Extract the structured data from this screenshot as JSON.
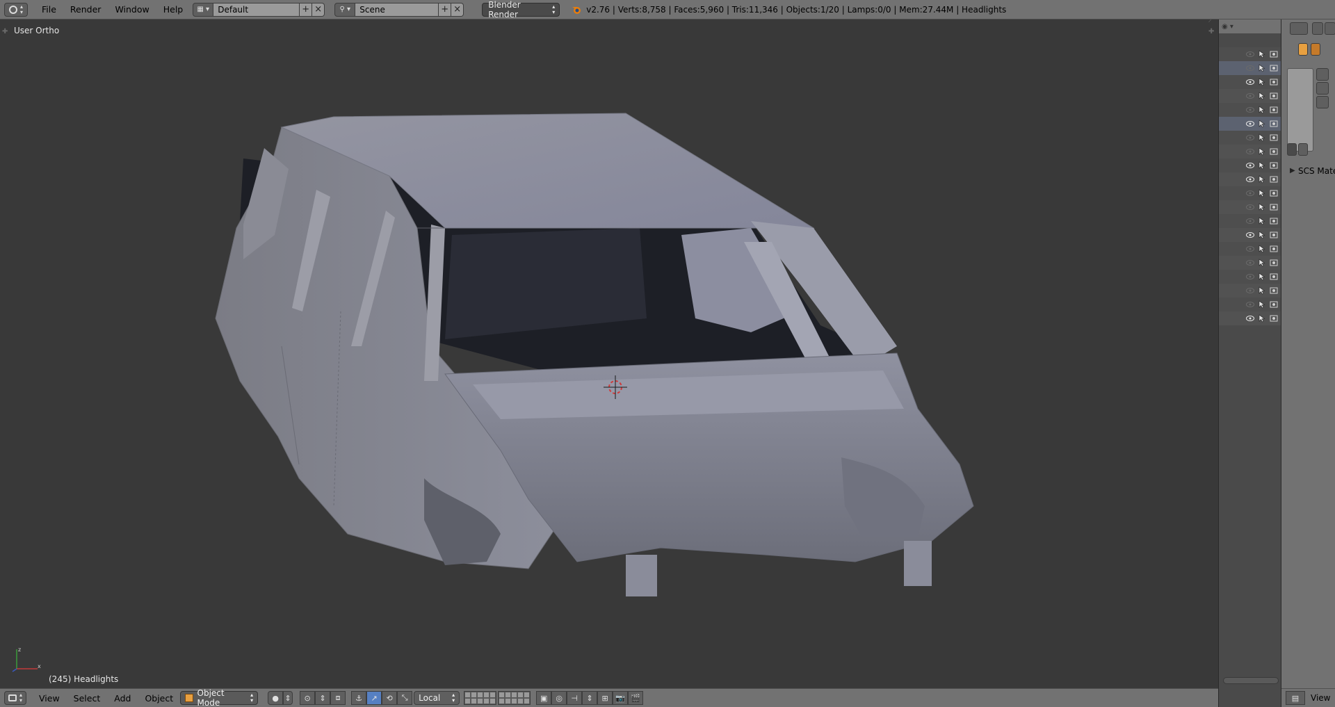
{
  "top_bar": {
    "menu": [
      "File",
      "Render",
      "Window",
      "Help"
    ],
    "screen_layout": "Default",
    "scene": "Scene",
    "render_engine": "Blender Render",
    "stats": "v2.76 | Verts:8,758 | Faces:5,960 | Tris:11,346 | Objects:1/20 | Lamps:0/0 | Mem:27.44M | Headlights"
  },
  "viewport": {
    "view_label": "User Ortho",
    "object_label": "(245) Headlights"
  },
  "bottom_bar": {
    "menu": [
      "View",
      "Select",
      "Add",
      "Object"
    ],
    "mode": "Object Mode",
    "orientation": "Local"
  },
  "outliner": {
    "rows": 20,
    "visible_rows": [
      3,
      6,
      9,
      10,
      14,
      20
    ]
  },
  "properties": {
    "panel_label": "SCS Mate",
    "footer_label": "View"
  },
  "colors": {
    "header": "#727272",
    "viewport": "#393939",
    "mesh": "#8a8d9c",
    "interior": "#1d1f26",
    "accent_blue": "#5680c2"
  }
}
